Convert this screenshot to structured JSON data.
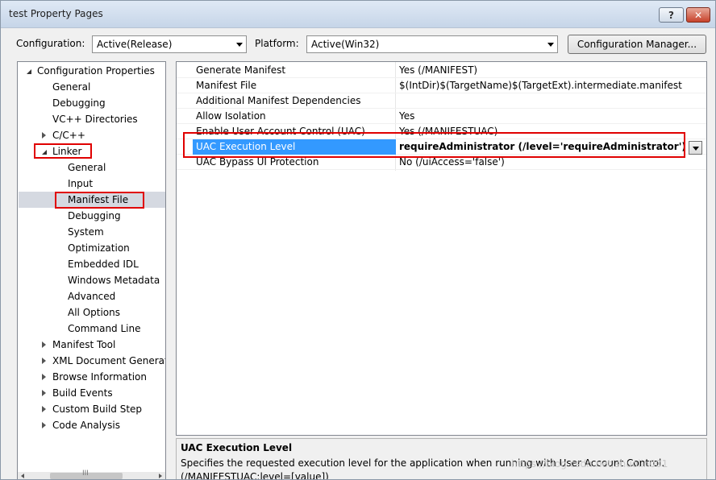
{
  "window": {
    "title": "test Property Pages",
    "help_label": "?",
    "close_label": "✕"
  },
  "toolbar": {
    "configuration_label": "Configuration:",
    "configuration_value": "Active(Release)",
    "platform_label": "Platform:",
    "platform_value": "Active(Win32)",
    "config_manager_label": "Configuration Manager..."
  },
  "tree": {
    "items": [
      {
        "label": "Configuration Properties",
        "expander": "expanded"
      },
      {
        "label": "General",
        "expander": ""
      },
      {
        "label": "Debugging",
        "expander": ""
      },
      {
        "label": "VC++ Directories",
        "expander": ""
      },
      {
        "label": "C/C++",
        "expander": "collapsed"
      },
      {
        "label": "Linker",
        "expander": "expanded"
      },
      {
        "label": "General",
        "expander": ""
      },
      {
        "label": "Input",
        "expander": ""
      },
      {
        "label": "Manifest File",
        "expander": ""
      },
      {
        "label": "Debugging",
        "expander": ""
      },
      {
        "label": "System",
        "expander": ""
      },
      {
        "label": "Optimization",
        "expander": ""
      },
      {
        "label": "Embedded IDL",
        "expander": ""
      },
      {
        "label": "Windows Metadata",
        "expander": ""
      },
      {
        "label": "Advanced",
        "expander": ""
      },
      {
        "label": "All Options",
        "expander": ""
      },
      {
        "label": "Command Line",
        "expander": ""
      },
      {
        "label": "Manifest Tool",
        "expander": "collapsed"
      },
      {
        "label": "XML Document Generat",
        "expander": "collapsed"
      },
      {
        "label": "Browse Information",
        "expander": "collapsed"
      },
      {
        "label": "Build Events",
        "expander": "collapsed"
      },
      {
        "label": "Custom Build Step",
        "expander": "collapsed"
      },
      {
        "label": "Code Analysis",
        "expander": "collapsed"
      }
    ],
    "scroll_grip": "III"
  },
  "properties": {
    "rows": [
      {
        "name": "Generate Manifest",
        "value": "Yes (/MANIFEST)"
      },
      {
        "name": "Manifest File",
        "value": "$(IntDir)$(TargetName)$(TargetExt).intermediate.manifest"
      },
      {
        "name": "Additional Manifest Dependencies",
        "value": ""
      },
      {
        "name": "Allow Isolation",
        "value": "Yes"
      },
      {
        "name": "Enable User Account Control (UAC)",
        "value": "Yes (/MANIFESTUAC)"
      },
      {
        "name": "UAC Execution Level",
        "value": "requireAdministrator (/level='requireAdministrator')"
      },
      {
        "name": "UAC Bypass UI Protection",
        "value": "No (/uiAccess='false')"
      }
    ]
  },
  "description": {
    "title": "UAC Execution Level",
    "text": "Specifies the requested execution level for the application when running with User Account Control.",
    "syntax": "(/MANIFESTUAC:level=[value])"
  },
  "watermark": "https://blog.csdn.net/shuolin001",
  "colors": {
    "selection": "#3399ff",
    "highlight_box": "#e00000",
    "tree_selection": "#d5d9e1"
  }
}
